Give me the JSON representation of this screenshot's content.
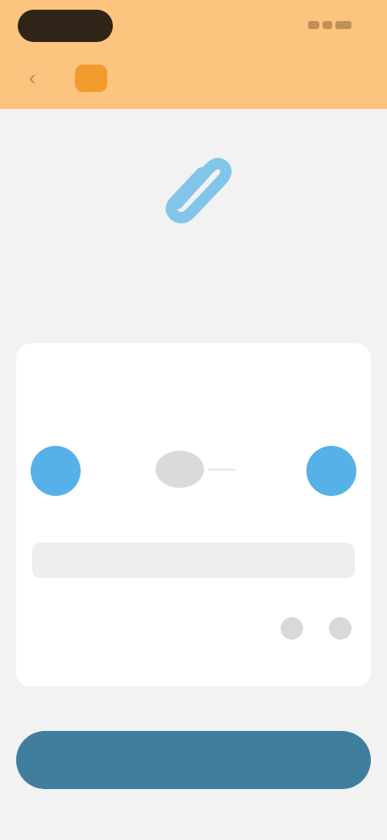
{
  "status_bar": {
    "time": "",
    "icons": [
      "signal-icon",
      "wifi-icon",
      "battery-icon"
    ]
  },
  "header": {
    "app_name": "",
    "back_icon": "chevron-left-icon",
    "accent_color": "#fcc47e",
    "badge_color": "#f39a2f"
  },
  "hero": {
    "icon": "paperclip-icon",
    "color": "#55b1e8"
  },
  "section": {
    "title": "",
    "subtitle": ""
  },
  "card": {
    "row1": {
      "label": "",
      "value": ""
    },
    "row2": {
      "label": "",
      "value": ""
    },
    "field": {
      "label": "",
      "value": "",
      "placeholder": ""
    },
    "toggle_row": {
      "label": ""
    }
  },
  "primary_button": {
    "label": "",
    "color": "#3f7e9e"
  }
}
